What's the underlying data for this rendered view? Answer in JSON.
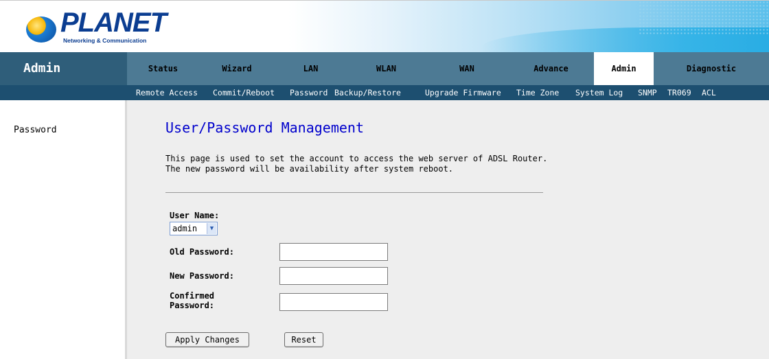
{
  "brand": {
    "name": "PLANET",
    "tagline": "Networking & Communication"
  },
  "section_title": "Admin",
  "main_tabs": [
    {
      "label": "Status",
      "active": false
    },
    {
      "label": "Wizard",
      "active": false
    },
    {
      "label": "LAN",
      "active": false
    },
    {
      "label": "WLAN",
      "active": false
    },
    {
      "label": "WAN",
      "active": false
    },
    {
      "label": "Advance",
      "active": false
    },
    {
      "label": "Admin",
      "active": true
    },
    {
      "label": "Diagnostic",
      "active": false
    }
  ],
  "sub_tabs": [
    "Remote Access",
    "Commit/Reboot",
    "Password",
    "Backup/Restore",
    "Upgrade Firmware",
    "Time Zone",
    "System Log",
    "SNMP",
    "TR069",
    "ACL"
  ],
  "sidebar": {
    "items": [
      "Password"
    ]
  },
  "page": {
    "title": "User/Password Management",
    "intro_line1": "This page is used to set the account to access the web server of ADSL Router.",
    "intro_line2": "The new password will be availability after system reboot."
  },
  "form": {
    "user_name_label": "User Name:",
    "user_name_value": "admin",
    "old_password_label": "Old Password:",
    "old_password_value": "",
    "new_password_label": "New Password:",
    "new_password_value": "",
    "confirmed_password_label_line1": "Confirmed",
    "confirmed_password_label_line2": "Password:",
    "confirmed_password_value": "",
    "apply_label": "Apply Changes",
    "reset_label": "Reset"
  },
  "colors": {
    "nav_bg": "#4d7a94",
    "section_bg": "#2f5e7a",
    "subnav_bg": "#1d4f70",
    "title_blue": "#0000cc",
    "content_bg": "#eeeeee"
  }
}
